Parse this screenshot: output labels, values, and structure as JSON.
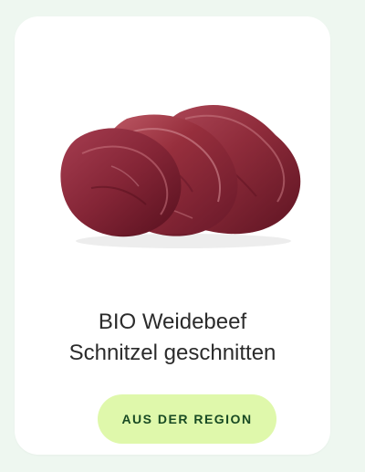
{
  "product": {
    "title_line_1": "BIO Weidebeef",
    "title_line_2": "Schnitzel geschnitten",
    "badge_label": "AUS DER REGION",
    "image_icon": "raw-beef-steaks-image"
  },
  "colors": {
    "page_background": "#eef7f0",
    "card_background": "#ffffff",
    "badge_background": "#dff8ab",
    "badge_text": "#184a23",
    "meat": "#8c2438"
  }
}
